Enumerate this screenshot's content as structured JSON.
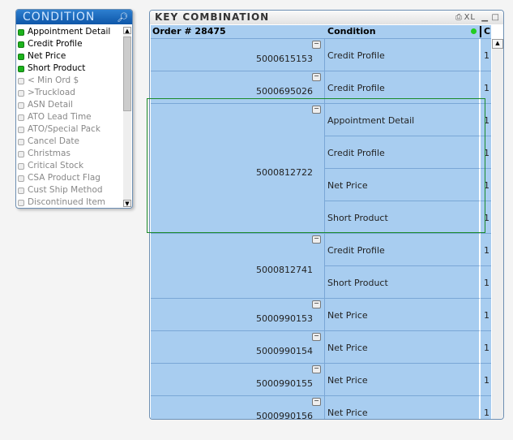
{
  "listbox": {
    "title": "CONDITION",
    "items": [
      {
        "label": "Appointment Detail",
        "selected": true
      },
      {
        "label": "Credit Profile",
        "selected": true
      },
      {
        "label": "Net Price",
        "selected": true
      },
      {
        "label": "Short Product",
        "selected": true
      },
      {
        "label": "< Min Ord $",
        "selected": false
      },
      {
        "label": ">Truckload",
        "selected": false
      },
      {
        "label": "ASN Detail",
        "selected": false
      },
      {
        "label": "ATO Lead Time",
        "selected": false
      },
      {
        "label": "ATO/Special Pack",
        "selected": false
      },
      {
        "label": "Cancel Date",
        "selected": false
      },
      {
        "label": "Christmas",
        "selected": false
      },
      {
        "label": "Critical Stock",
        "selected": false
      },
      {
        "label": "CSA Product Flag",
        "selected": false
      },
      {
        "label": "Cust Ship Method",
        "selected": false
      },
      {
        "label": "Discontinued Item",
        "selected": false
      }
    ]
  },
  "table": {
    "title": "KEY COMBINATION",
    "icons": {
      "print": "⎙",
      "xl": "XL",
      "min": "▁",
      "max": "□"
    },
    "headers": {
      "order": "Order # 28475",
      "condition": "Condition",
      "count": "C"
    },
    "groups": [
      {
        "order": "5000615153",
        "rows": [
          {
            "condition": "Credit Profile",
            "count": "1"
          }
        ]
      },
      {
        "order": "5000695026",
        "rows": [
          {
            "condition": "Credit Profile",
            "count": "1"
          }
        ]
      },
      {
        "order": "5000812722",
        "rows": [
          {
            "condition": "Appointment Detail",
            "count": "1"
          },
          {
            "condition": "Credit Profile",
            "count": "1"
          },
          {
            "condition": "Net Price",
            "count": "1"
          },
          {
            "condition": "Short Product",
            "count": "1"
          }
        ]
      },
      {
        "order": "5000812741",
        "rows": [
          {
            "condition": "Credit Profile",
            "count": "1"
          },
          {
            "condition": "Short Product",
            "count": "1"
          }
        ]
      },
      {
        "order": "5000990153",
        "rows": [
          {
            "condition": "Net Price",
            "count": "1"
          }
        ]
      },
      {
        "order": "5000990154",
        "rows": [
          {
            "condition": "Net Price",
            "count": "1"
          }
        ]
      },
      {
        "order": "5000990155",
        "rows": [
          {
            "condition": "Net Price",
            "count": "1"
          }
        ]
      },
      {
        "order": "5000990156",
        "rows": [
          {
            "condition": "Net Price",
            "count": "1"
          }
        ]
      }
    ]
  }
}
